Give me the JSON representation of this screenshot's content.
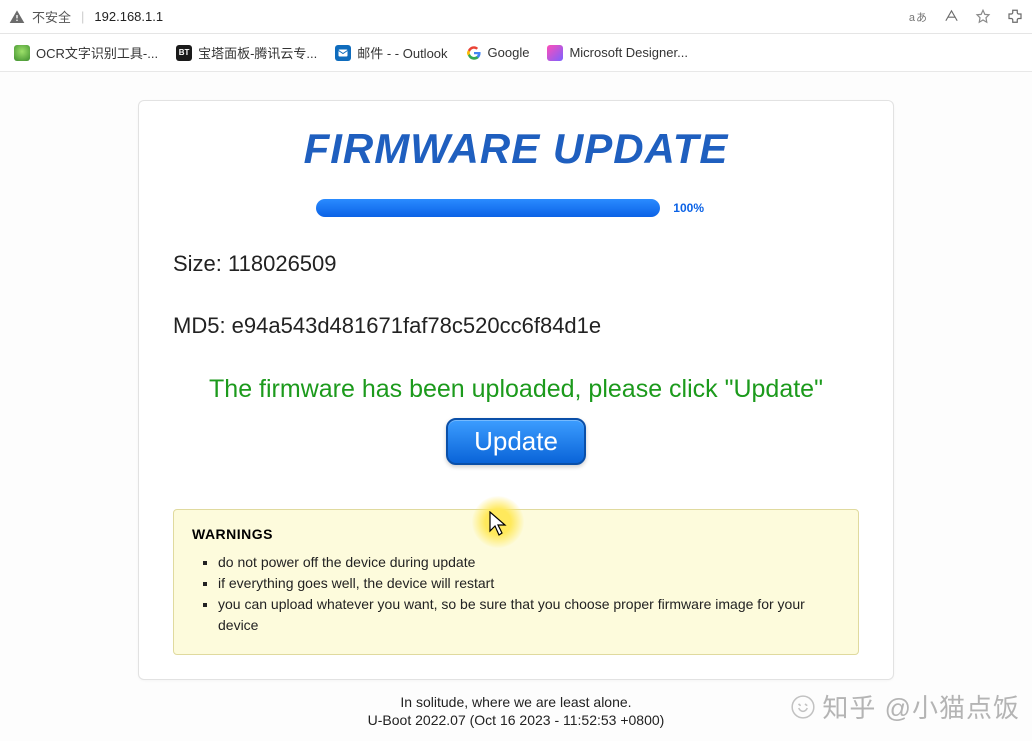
{
  "browser": {
    "security_label": "不安全",
    "url": "192.168.1.1",
    "lang_indicator": "aあ"
  },
  "bookmarks": [
    {
      "label": "OCR文字识别工具-..."
    },
    {
      "label": "宝塔面板-腾讯云专..."
    },
    {
      "label": "邮件 - - Outlook"
    },
    {
      "label": "Google"
    },
    {
      "label": "Microsoft Designer..."
    }
  ],
  "page": {
    "title": "FIRMWARE UPDATE",
    "progress_percent": "100%",
    "file_size_label": "Size: 118026509",
    "md5_label": "MD5: e94a543d481671faf78c520cc6f84d1e",
    "status_msg": "The firmware has been uploaded, please click \"Update\"",
    "update_btn": "Update",
    "warnings_heading": "WARNINGS",
    "warnings": [
      "do not power off the device during update",
      "if everything goes well, the device will restart",
      "you can upload whatever you want, so be sure that you choose proper firmware image for your device"
    ]
  },
  "footer": {
    "quote": "In solitude, where we are least alone.",
    "build": "U-Boot 2022.07 (Oct 16 2023 - 11:52:53 +0800)"
  },
  "watermark": "知乎 @小猫点饭"
}
